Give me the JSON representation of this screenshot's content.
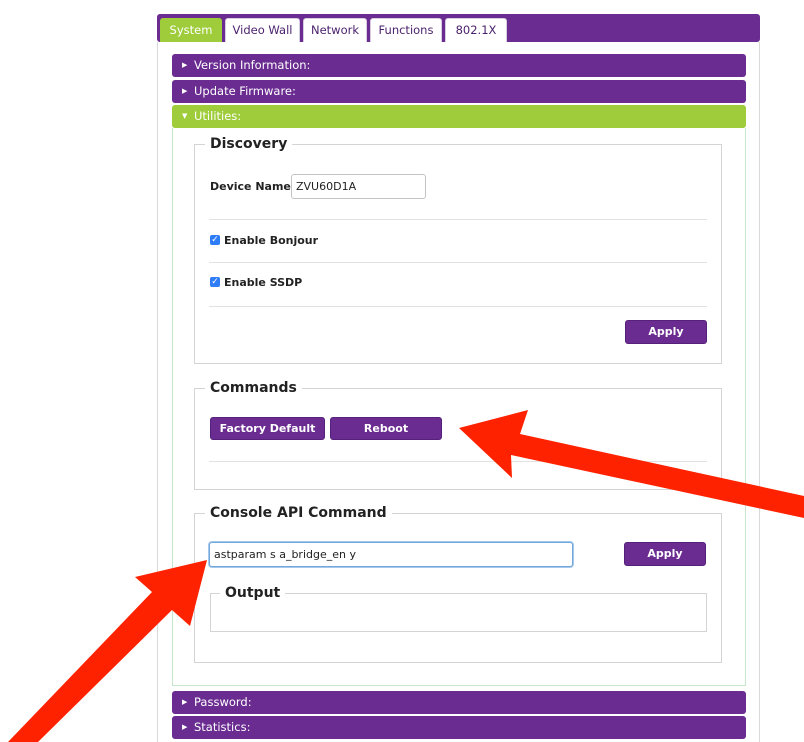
{
  "tabs": [
    {
      "label": "System",
      "active": true
    },
    {
      "label": "Video Wall",
      "active": false
    },
    {
      "label": "Network",
      "active": false
    },
    {
      "label": "Functions",
      "active": false
    },
    {
      "label": "802.1X",
      "active": false
    }
  ],
  "accordion": {
    "version_information": "Version Information:",
    "update_firmware": "Update Firmware:",
    "utilities": "Utilities:",
    "password": "Password:",
    "statistics": "Statistics:"
  },
  "discovery": {
    "title": "Discovery",
    "device_name_label": "Device Name:",
    "device_name_value": "ZVU60D1A",
    "enable_bonjour_label": "Enable Bonjour",
    "enable_bonjour_checked": true,
    "enable_ssdp_label": "Enable SSDP",
    "enable_ssdp_checked": true,
    "apply_label": "Apply"
  },
  "commands": {
    "title": "Commands",
    "factory_default_label": "Factory Default",
    "reboot_label": "Reboot"
  },
  "console": {
    "title": "Console API Command",
    "command_value": "astparam s a_bridge_en y",
    "apply_label": "Apply",
    "output_title": "Output"
  },
  "colors": {
    "brand_purple": "#6a2c91",
    "accent_green": "#9fcc3b",
    "annotation_red": "#ff2200"
  }
}
